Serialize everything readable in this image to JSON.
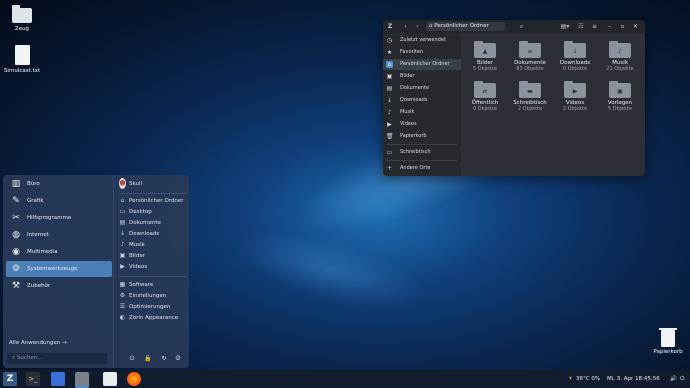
{
  "desktop": {
    "icons": [
      {
        "label": "Zeug",
        "icon": "folder-icon"
      },
      {
        "label": "Simulcast.txt",
        "icon": "text-file-icon"
      }
    ],
    "trash_label": "Papierkorb"
  },
  "file_manager": {
    "path_label": "Persönlicher Ordner",
    "sidebar": [
      {
        "label": "Zuletzt verwendet",
        "icon": "recent-icon"
      },
      {
        "label": "Favoriten",
        "icon": "star-icon"
      },
      {
        "label": "Persönlicher Ordner",
        "icon": "home-icon",
        "active": true
      },
      {
        "label": "Bilder",
        "icon": "pictures-icon"
      },
      {
        "label": "Dokumente",
        "icon": "documents-icon"
      },
      {
        "label": "Downloads",
        "icon": "download-icon"
      },
      {
        "label": "Musik",
        "icon": "music-icon"
      },
      {
        "label": "Videos",
        "icon": "video-icon"
      },
      {
        "label": "Papierkorb",
        "icon": "trash-icon"
      },
      {
        "label": "Schreibtisch",
        "icon": "desktop-icon"
      },
      {
        "label": "Andere Orte",
        "icon": "plus-icon"
      }
    ],
    "folders": [
      {
        "name": "Bilder",
        "count": "5 Objekte",
        "glyph": "▲"
      },
      {
        "name": "Dokumente",
        "count": "83 Objekte",
        "glyph": "≡"
      },
      {
        "name": "Downloads",
        "count": "0 Objekte",
        "glyph": "↓"
      },
      {
        "name": "Musik",
        "count": "21 Objekte",
        "glyph": "♪"
      },
      {
        "name": "Öffentlich",
        "count": "0 Objekte",
        "glyph": "⇄"
      },
      {
        "name": "Schreibtisch",
        "count": "2 Objekte",
        "glyph": "▬"
      },
      {
        "name": "Videos",
        "count": "2 Objekte",
        "glyph": "▶"
      },
      {
        "name": "Vorlagen",
        "count": "5 Objekte",
        "glyph": "▣"
      }
    ]
  },
  "start_menu": {
    "categories": [
      {
        "label": "Büro",
        "icon": "office-icon"
      },
      {
        "label": "Grafik",
        "icon": "graphics-icon"
      },
      {
        "label": "Hilfsprogramme",
        "icon": "utilities-icon"
      },
      {
        "label": "Internet",
        "icon": "internet-icon"
      },
      {
        "label": "Multimedia",
        "icon": "multimedia-icon"
      },
      {
        "label": "Systemwerkzeuge",
        "icon": "system-tools-icon",
        "active": true
      },
      {
        "label": "Zubehör",
        "icon": "accessories-icon"
      }
    ],
    "all_apps_label": "Alle Anwendungen",
    "search_placeholder": "Suchen...",
    "user_name": "Skull",
    "places": [
      {
        "label": "Persönlicher Ordner",
        "icon": "home-icon"
      },
      {
        "label": "Desktop",
        "icon": "desktop-icon"
      },
      {
        "label": "Dokumente",
        "icon": "documents-icon"
      },
      {
        "label": "Downloads",
        "icon": "download-icon"
      },
      {
        "label": "Musik",
        "icon": "music-icon"
      },
      {
        "label": "Bilder",
        "icon": "pictures-icon"
      },
      {
        "label": "Videos",
        "icon": "video-icon"
      }
    ],
    "system": [
      {
        "label": "Software",
        "icon": "software-icon"
      },
      {
        "label": "Einstellungen",
        "icon": "settings-icon"
      },
      {
        "label": "Optimierungen",
        "icon": "tweaks-icon"
      },
      {
        "label": "Zorin Appearance",
        "icon": "appearance-icon"
      }
    ]
  },
  "taskbar": {
    "weather": "36°C 0%",
    "datetime": "Mi, 3. Apr  18:45:56"
  },
  "colors": {
    "accent": "#4a90d9",
    "menu_active": "#4a7fb8"
  }
}
